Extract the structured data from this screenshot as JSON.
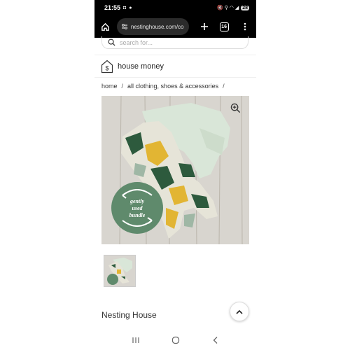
{
  "status_bar": {
    "time": "21:55",
    "left_icons": "◘ ●",
    "right_icons": "🔇 ⚲ ◠ ◢",
    "battery": "28"
  },
  "browser": {
    "url": "nestinghouse.com/co",
    "tab_count": "16"
  },
  "search": {
    "placeholder": "search for..."
  },
  "brand": {
    "name": "house money"
  },
  "breadcrumb": {
    "items": [
      "home",
      "all clothing, shoes & accessories"
    ],
    "separator": "/"
  },
  "product": {
    "badge_lines": [
      "gently",
      "used",
      "bundle"
    ],
    "badge_color": "#5f8a6c"
  },
  "footer": {
    "store_name": "Nesting House"
  },
  "colors": {
    "accent_green": "#5f8a6c",
    "wood": "#d6d3cd"
  }
}
